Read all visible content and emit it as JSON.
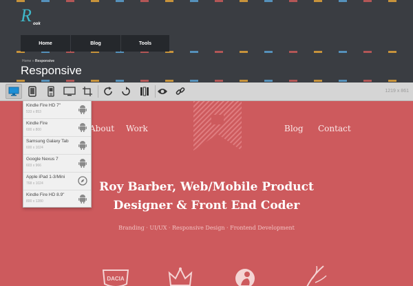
{
  "header": {
    "logo": {
      "letter": "R",
      "sub": "ook"
    },
    "nav": [
      "Home",
      "Blog",
      "Tools"
    ],
    "breadcrumb": {
      "home": "Home",
      "sep": "»",
      "current": "Responsive"
    },
    "title": "Responsive"
  },
  "toolbar": {
    "dimensions": "1219 x 861",
    "buttons": [
      "desktop-icon",
      "tablet-icon",
      "phone-icon",
      "widescreen-icon",
      "crop-icon",
      "rotate-icon",
      "refresh-icon",
      "columns-icon",
      "eye-icon",
      "link-icon"
    ]
  },
  "dropdown": {
    "items": [
      {
        "name": "Kindle Fire HD 7\"",
        "size": "533 x 853",
        "icon": "android-icon"
      },
      {
        "name": "Kindle Fire",
        "size": "600 x 800",
        "icon": "android-icon"
      },
      {
        "name": "Samsung Galaxy Tab",
        "size": "600 x 1024",
        "icon": "android-icon"
      },
      {
        "name": "Google Nexus 7",
        "size": "603 x 966",
        "icon": "android-icon"
      },
      {
        "name": "Apple iPad 1-3/Mini",
        "size": "768 x 1024",
        "icon": "safari-icon"
      },
      {
        "name": "Kindle Fire HD 8.9\"",
        "size": "800 x 1280",
        "icon": "android-icon"
      }
    ]
  },
  "site": {
    "nav": {
      "about": "About",
      "work": "Work",
      "blog": "Blog",
      "contact": "Contact"
    },
    "hero_line1": "Roy Barber, Web/Mobile Product",
    "hero_line2": "Designer & Front End Coder",
    "tagline": "Branding · UI/UX · Responsive Design · Frontend Development",
    "client_logo_text": "DACIA"
  },
  "colors": {
    "accent": "#cd5a5d",
    "header": "#3a3d42",
    "toolbar": "#d5d5d5",
    "active_icon": "#1e8fd6"
  }
}
